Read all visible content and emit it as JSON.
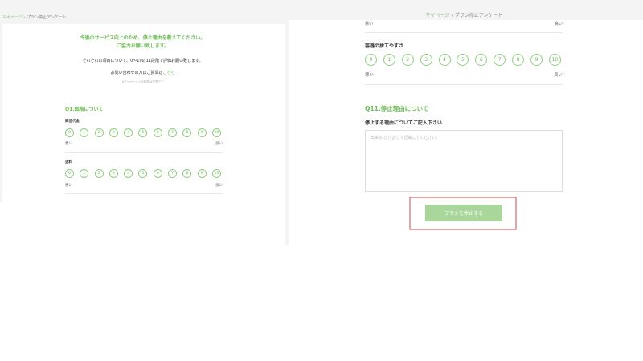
{
  "left": {
    "breadcrumb": {
      "home": "マイページ",
      "sep": "›",
      "current": "プラン停止アンケート"
    },
    "intro": {
      "line1": "今後のサービス向上のため、停止理由を教えてください。",
      "line2": "ご協力お願い致します。",
      "instruction": "それぞれの項目について、0〜10の11段階で評価お願い致します。",
      "contact_text": "お問い合わせの方はご質問は",
      "contact_link": "こちら",
      "small_note": "※アンケートへの回答は任意です"
    },
    "q1": {
      "title": "Q1.価格について",
      "items": [
        {
          "label": "商品代金",
          "low": "悪い",
          "high": "良い"
        },
        {
          "label": "送料",
          "low": "悪い",
          "high": "良い"
        }
      ]
    }
  },
  "right": {
    "breadcrumb": {
      "home": "マイページ",
      "sep": "›",
      "current": "プラン停止アンケート"
    },
    "top_scale": {
      "low": "悪い",
      "high": "良い"
    },
    "container_item": {
      "label": "容器の捨てやすさ",
      "low": "悪い",
      "high": "良い"
    },
    "q11": {
      "title": "Q11.停止理由について",
      "prompt": "停止する理由についてご記入下さい",
      "placeholder": "出来る だけ詳しく記載してください。"
    },
    "stop_button": "プランを停止する"
  },
  "scale": [
    "0",
    "1",
    "2",
    "3",
    "4",
    "5",
    "6",
    "7",
    "8",
    "9",
    "10"
  ],
  "colors": {
    "accent": "#6cbb55",
    "button": "#a9d79b",
    "highlight": "#e7a3a3"
  }
}
